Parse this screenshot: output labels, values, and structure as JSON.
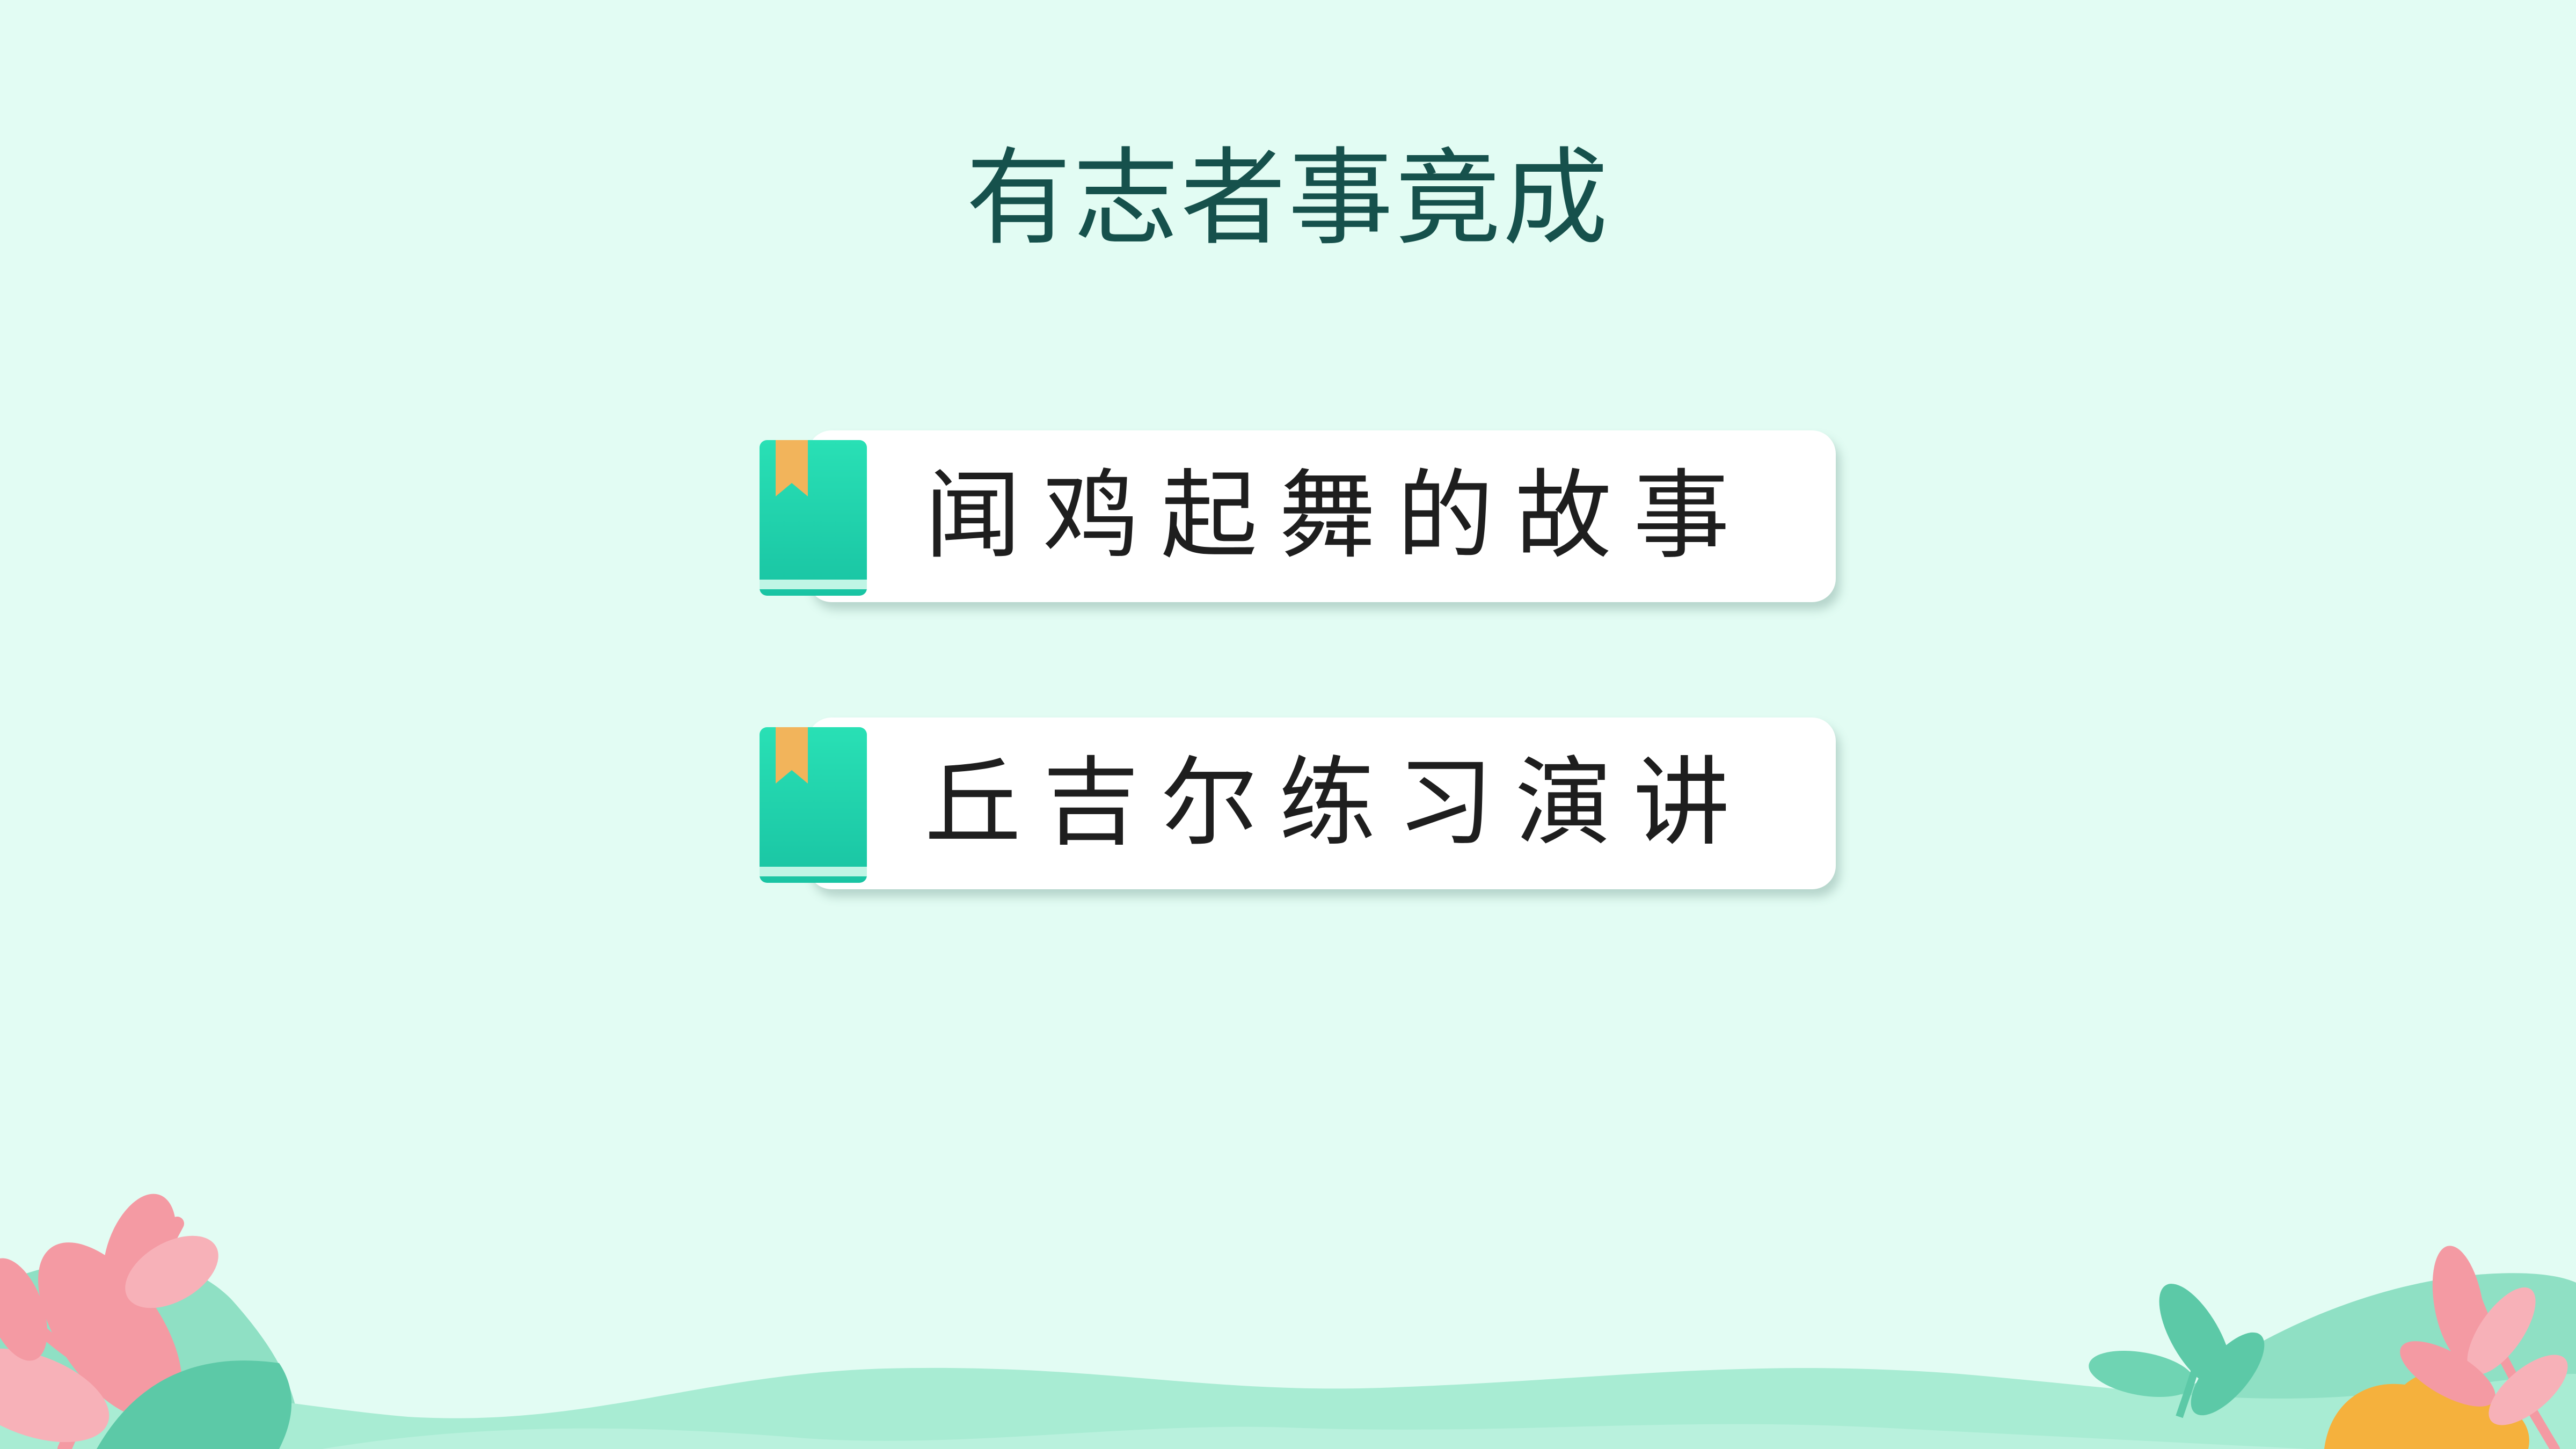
{
  "title": "有志者事竟成",
  "items": [
    {
      "label": "闻鸡起舞的故事",
      "icon": "book-icon"
    },
    {
      "label": "丘吉尔练习演讲",
      "icon": "book-icon"
    }
  ],
  "colors": {
    "background": "#e2fcf3",
    "title": "#16514c",
    "book_teal": "#22d3a8",
    "bookmark": "#f2b45b",
    "leaf_pink": "#f49aa3",
    "leaf_green": "#5cc9a7",
    "hill_green": "#a8ecd3",
    "flower_orange": "#f5b13d"
  }
}
